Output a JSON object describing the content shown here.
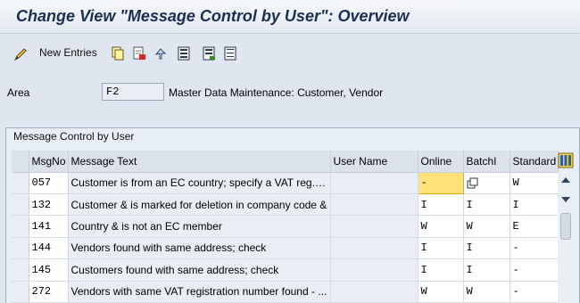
{
  "title": "Change View \"Message Control by User\": Overview",
  "toolbar": {
    "new_entries_label": "New Entries",
    "icons": [
      "edit-pen-icon",
      "copy-icon",
      "delete-icon",
      "undo-icon",
      "select-all-icon",
      "select-block-icon",
      "deselect-all-icon"
    ]
  },
  "area": {
    "label": "Area",
    "value": "F2",
    "description": "Master Data Maintenance: Customer, Vendor"
  },
  "group": {
    "title": "Message Control by User"
  },
  "table": {
    "columns": [
      "MsgNo",
      "Message Text",
      "User Name",
      "Online",
      "BatchI",
      "Standard"
    ],
    "rows": [
      {
        "msgno": "057",
        "text": "Customer is from an EC country; specify a VAT reg.no.",
        "user": "",
        "online": "-",
        "batch": "",
        "standard": "W"
      },
      {
        "msgno": "132",
        "text": "Customer & is marked for deletion in company code &",
        "user": "",
        "online": "I",
        "batch": "I",
        "standard": "I"
      },
      {
        "msgno": "141",
        "text": "Country & is not an EC member",
        "user": "",
        "online": "W",
        "batch": "W",
        "standard": "E"
      },
      {
        "msgno": "144",
        "text": "Vendors found with same address; check",
        "user": "",
        "online": "I",
        "batch": "I",
        "standard": "-"
      },
      {
        "msgno": "145",
        "text": "Customers found with same address; check",
        "user": "",
        "online": "I",
        "batch": "I",
        "standard": "-"
      },
      {
        "msgno": "272",
        "text": "Vendors with same VAT registration number found - ...",
        "user": "",
        "online": "W",
        "batch": "W",
        "standard": "-"
      }
    ]
  },
  "colors": {
    "accent": "#f0a800",
    "title_text": "#1b2f4f"
  }
}
